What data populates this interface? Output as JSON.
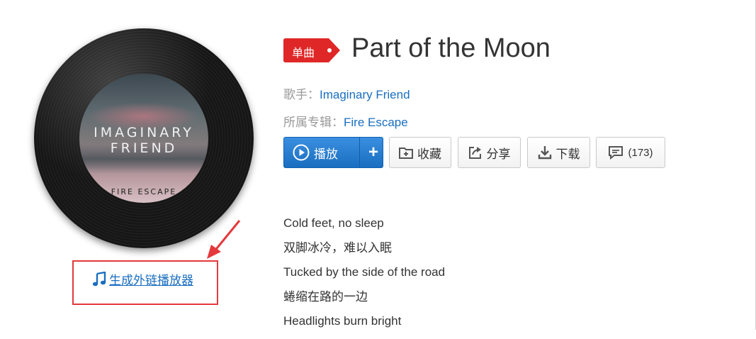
{
  "album_cover": {
    "title_line1": "IMAGINARY",
    "title_line2": "FRIEND",
    "subtitle": "FIRE ESCAPE"
  },
  "external_player_link": {
    "label": "生成外链播放器",
    "icon": "music-note-icon"
  },
  "song": {
    "tag": "单曲",
    "title": "Part of the Moon",
    "artist_label": "歌手：",
    "artist": "Imaginary Friend",
    "album_label": "所属专辑：",
    "album": "Fire Escape"
  },
  "actions": {
    "play_label": "播放",
    "add_label": "+",
    "favorite_label": "收藏",
    "share_label": "分享",
    "download_label": "下载",
    "comments_label": "(173)"
  },
  "lyrics": [
    "Cold feet, no sleep",
    "双脚冰冷，难以入眠",
    "Tucked by the side of the road",
    "蜷缩在路的一边",
    "Headlights burn bright"
  ],
  "colors": {
    "accent": "#1a6ec0",
    "tag_red": "#e02727",
    "highlight_red": "#e4393c"
  }
}
